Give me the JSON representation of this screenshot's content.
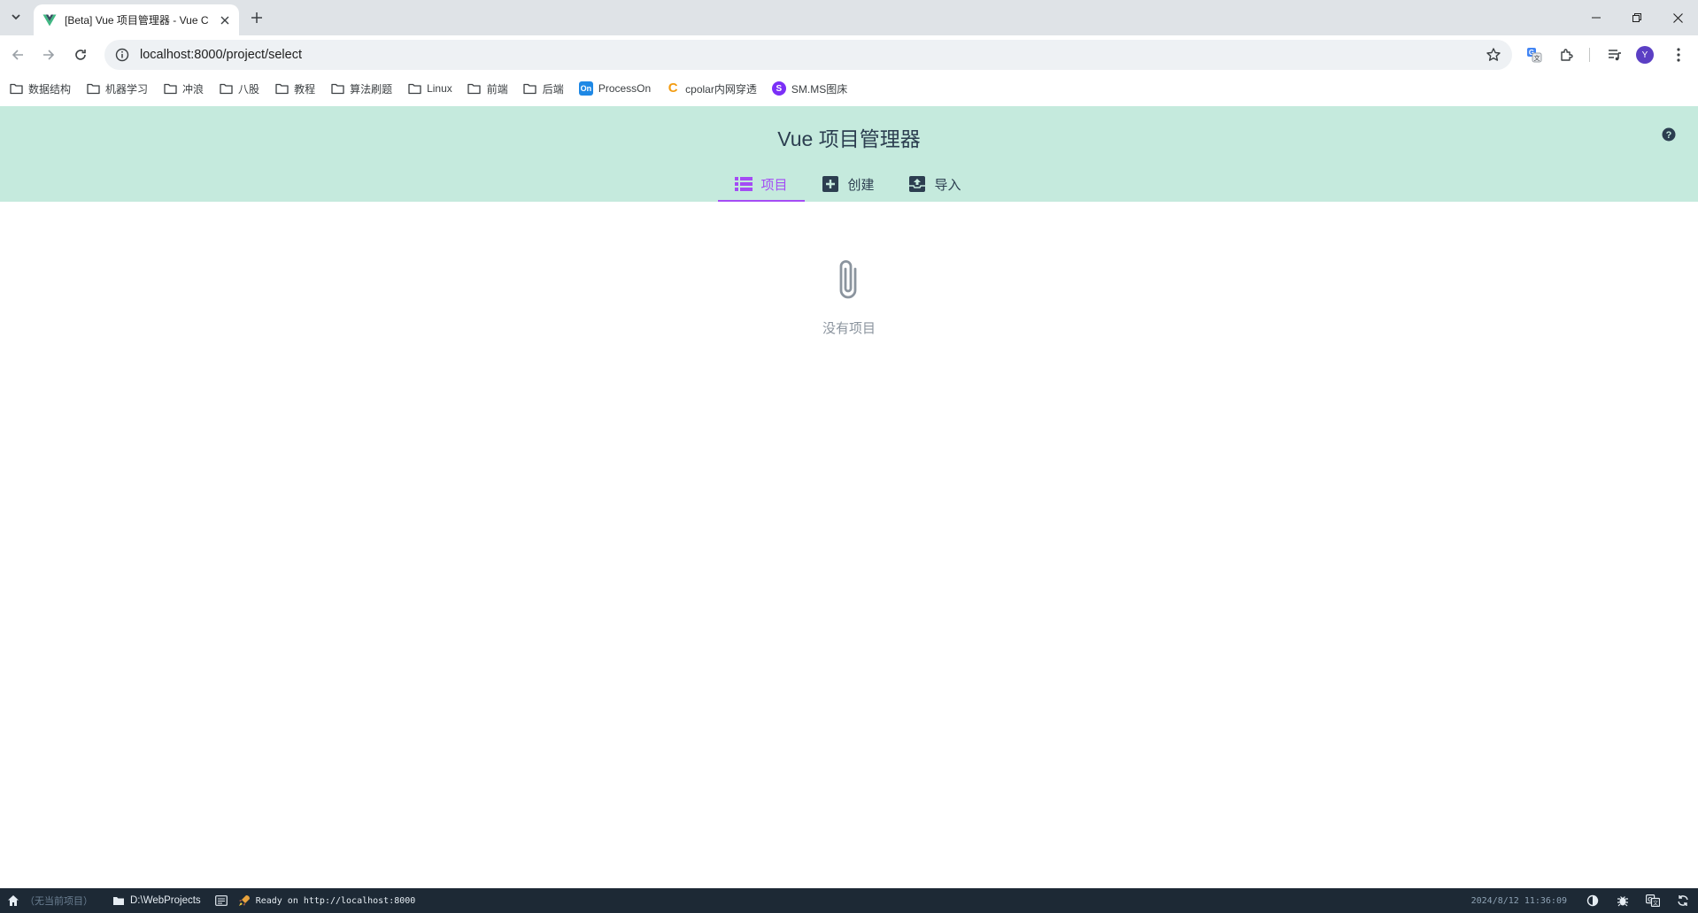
{
  "browser": {
    "tab": {
      "title": "[Beta] Vue 项目管理器 - Vue C",
      "favicon": "vue-logo-icon"
    },
    "address": {
      "url": "localhost:8000/project/select"
    },
    "profile_initial": "Y",
    "bookmarks": [
      {
        "label": "数据结构",
        "icon": "folder-icon"
      },
      {
        "label": "机器学习",
        "icon": "folder-icon"
      },
      {
        "label": "冲浪",
        "icon": "folder-icon"
      },
      {
        "label": "八股",
        "icon": "folder-icon"
      },
      {
        "label": "教程",
        "icon": "folder-icon"
      },
      {
        "label": "算法刷题",
        "icon": "folder-icon"
      },
      {
        "label": "Linux",
        "icon": "folder-icon"
      },
      {
        "label": "前端",
        "icon": "folder-icon"
      },
      {
        "label": "后端",
        "icon": "folder-icon"
      },
      {
        "label": "ProcessOn",
        "icon": "processon-icon",
        "badge": "On"
      },
      {
        "label": "cpolar内网穿透",
        "icon": "cpolar-icon",
        "badge": "C"
      },
      {
        "label": "SM.MS图床",
        "icon": "smms-icon",
        "badge": "S"
      }
    ]
  },
  "app": {
    "title": "Vue 项目管理器",
    "nav": [
      {
        "label": "项目",
        "icon": "list-icon",
        "active": true
      },
      {
        "label": "创建",
        "icon": "add-box-icon",
        "active": false
      },
      {
        "label": "导入",
        "icon": "unarchive-icon",
        "active": false
      }
    ],
    "empty_state": {
      "icon": "attachment-icon",
      "text": "没有项目"
    }
  },
  "statusbar": {
    "current_project": "（无当前项目）",
    "folder": "D:\\WebProjects",
    "log": "Ready on http://localhost:8000",
    "datetime": "2024/8/12 11:36:09"
  },
  "colors": {
    "header_bg": "#c5eadd",
    "accent": "#a44cf4",
    "statusbar_bg": "#1d2935",
    "text": "#2c3e50"
  }
}
